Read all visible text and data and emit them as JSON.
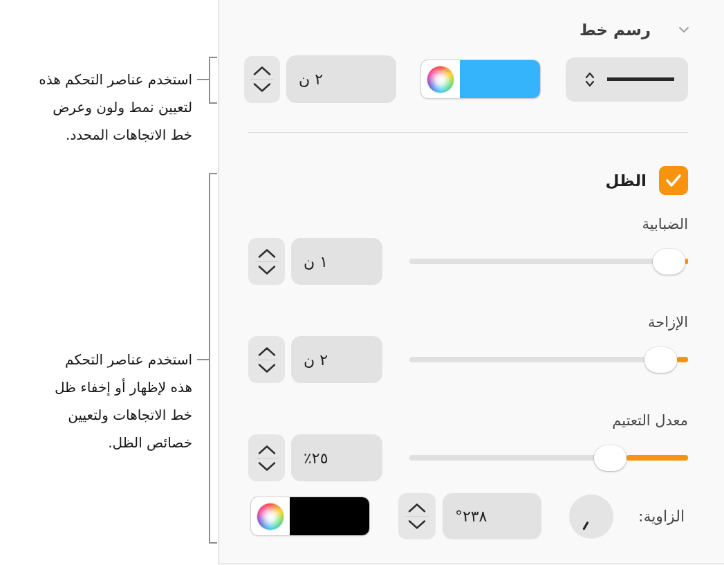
{
  "callouts": [
    {
      "text": "استخدم عناصر التحكم هذه لتعيين نمط ولون وعرض خط الاتجاهات المحدد."
    },
    {
      "text": "استخدم عناصر التحكم هذه لإظهار أو إخفاء ظل خط الاتجاهات ولتعيين خصائص الظل."
    }
  ],
  "stroke": {
    "title": "رسم خط",
    "expanded": true,
    "color": "#35b3fb",
    "width": "٢ ن"
  },
  "shadow": {
    "label": "الظل",
    "checked": true,
    "sliders": [
      {
        "label": "الضبابية",
        "value": "١ ن",
        "level": 0.01
      },
      {
        "label": "الإزاحة",
        "value": "٢ ن",
        "level": 0.04
      },
      {
        "label": "معدل التعتيم",
        "value": "٢٥٪",
        "level": 0.22
      }
    ],
    "angle": {
      "label": "الزاوية:",
      "value": "٢٣٨°"
    },
    "color": "#000000"
  }
}
